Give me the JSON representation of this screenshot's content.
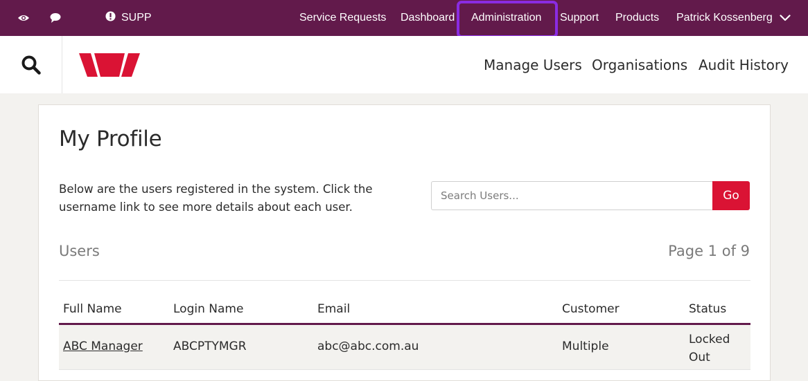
{
  "topbar": {
    "icons": [
      "eye-icon",
      "chat-bubble-icon",
      "info-icon"
    ],
    "org_code": "SUPP",
    "nav": [
      {
        "label": "Service Requests"
      },
      {
        "label": "Dashboard"
      },
      {
        "label": "Administration"
      },
      {
        "label": "Support"
      },
      {
        "label": "Products"
      }
    ],
    "user_name": "Patrick Kossenberg",
    "colors": {
      "background": "#621a4b",
      "highlight": "#8a2be2"
    }
  },
  "header": {
    "search_icon": "search-icon",
    "logo": "westpac-logo",
    "nav": [
      {
        "label": "Manage Users"
      },
      {
        "label": "Organisations"
      },
      {
        "label": "Audit History"
      }
    ],
    "colors": {
      "logo": "#da1334"
    }
  },
  "main": {
    "title": "My Profile",
    "intro": "Below are the users registered in the system. Click the username link to see more details about each user.",
    "search": {
      "placeholder": "Search Users...",
      "value": "",
      "button_label": "Go",
      "button_color": "#da1334"
    },
    "section_title": "Users",
    "pagination": "Page 1 of 9",
    "table": {
      "columns": [
        "Full Name",
        "Login Name",
        "Email",
        "Customer",
        "Status"
      ],
      "rows": [
        {
          "full_name": "ABC Manager",
          "login_name": "ABCPTYMGR",
          "email": "abc@abc.com.au",
          "customer": "Multiple",
          "status": "Locked Out"
        }
      ]
    }
  }
}
